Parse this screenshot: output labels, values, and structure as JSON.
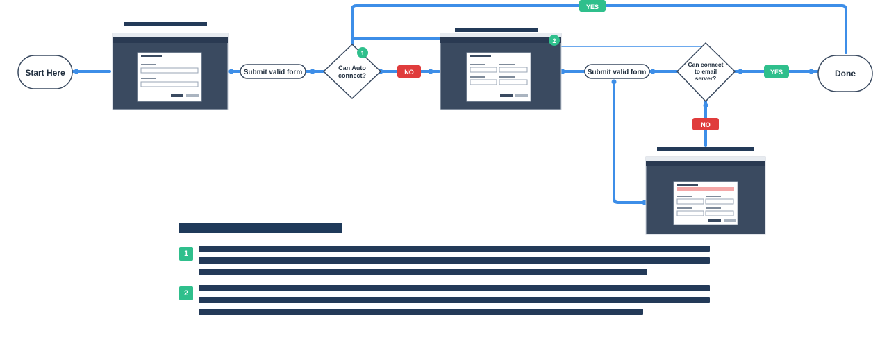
{
  "nodes": {
    "start": "Start Here",
    "done": "Done",
    "decision_auto": [
      "Can Auto",
      "connect?"
    ],
    "decision_email": [
      "Can connect",
      "to email",
      "server?"
    ]
  },
  "labels": {
    "submit_1": "Submit valid form",
    "submit_2": "Submit valid form",
    "yes_top": "YES",
    "yes_right": "YES",
    "no_1": "NO",
    "no_2": "NO"
  },
  "markers": {
    "m1": "1",
    "m2": "2"
  },
  "legend": {
    "items": [
      {
        "number": "1"
      },
      {
        "number": "2"
      }
    ]
  },
  "colors": {
    "line": "#3d8ee8",
    "yes": "#2fbf8c",
    "no": "#e03c3c",
    "screen": "#3a4a60",
    "node_border": "#3a4a60"
  }
}
